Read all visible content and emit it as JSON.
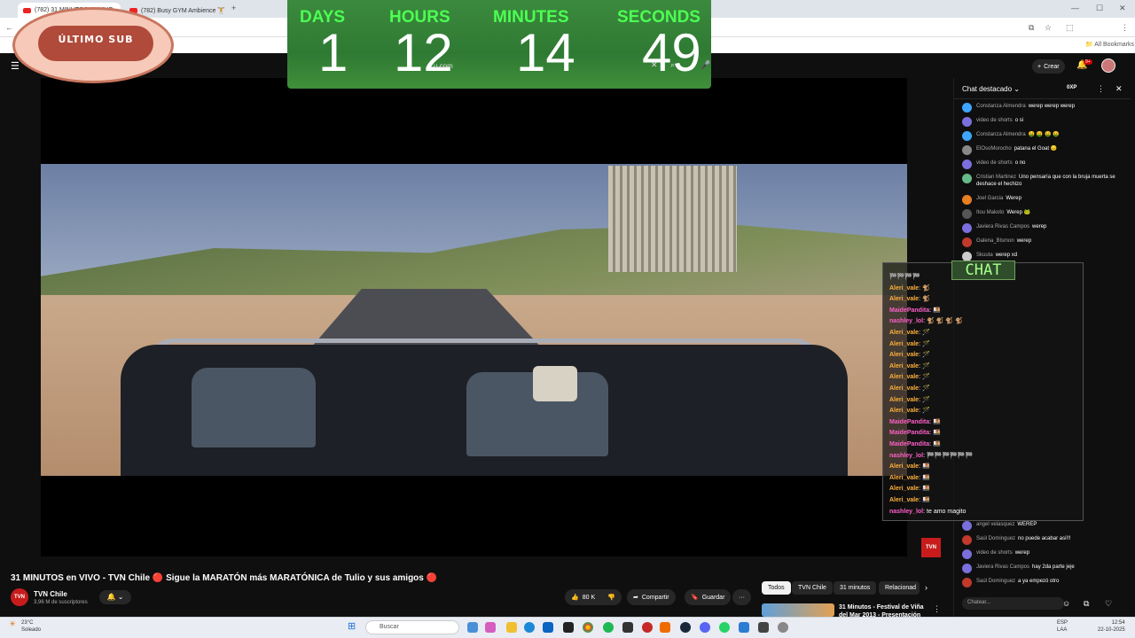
{
  "browser": {
    "tabs": [
      {
        "label": "(782) 31 MINUTOS en VIVO -",
        "active": true
      },
      {
        "label": "(782) Busy GYM Ambience 🏋",
        "active": false
      }
    ],
    "new_tab": "+",
    "bookmarks_label": "All Bookmarks",
    "notification_count": "9+"
  },
  "timer": {
    "labels": [
      "DAYS",
      "HOURS",
      "MINUTES",
      "SECONDS"
    ],
    "values": [
      "1",
      "12",
      "14",
      "49"
    ]
  },
  "overlay_badge": {
    "text": "ÚLTIMO SUB"
  },
  "youtube": {
    "create_label": "Crear",
    "search_hint": "u.com"
  },
  "video": {
    "title": "31 MINUTOS en VIVO - TVN Chile 🔴 Sigue la MARATÓN más MARATÓNICA de Tulio y sus amigos 🔴",
    "channel": "TVN Chile",
    "subscribers": "3,96 M de suscriptores",
    "channel_initials": "TVN",
    "likes": "80 K",
    "share": "Compartir",
    "save": "Guardar",
    "more": "···",
    "logo": "TVN"
  },
  "chips": [
    "Todos",
    "TVN Chile",
    "31 minutos",
    "Relacionad"
  ],
  "recommendation": {
    "title": "31 Minutos - Festival de Viña del Mar 2013 - Presentación"
  },
  "chat": {
    "title": "Chat destacado",
    "oxp": "0XP",
    "input_placeholder": "Chatear...",
    "messages": [
      {
        "author": "Constanza Almendra",
        "text": "werep werep werep",
        "color": "#3ea6ff"
      },
      {
        "author": "video de shorts",
        "text": "o si",
        "color": "#7a6fdc"
      },
      {
        "author": "Constanza Almendra",
        "text": "🤑 🤑 🤑 🤑",
        "color": "#3ea6ff"
      },
      {
        "author": "ElOsoMorocho",
        "text": "patana el Goat 😔",
        "color": "#888"
      },
      {
        "author": "video de shorts",
        "text": "o no",
        "color": "#7a6fdc"
      },
      {
        "author": "Cristian Martinez",
        "text": "Uno pensaría que con la bruja muerta se deshace el hechizo",
        "color": "#6b8"
      },
      {
        "author": "Joel Garcia",
        "text": "Werep",
        "color": "#e67e22"
      },
      {
        "author": "Itou Makoto",
        "text": "Werep 🐸",
        "color": "#555"
      },
      {
        "author": "Javiera Rivas Campos",
        "text": "werep",
        "color": "#7a6fdc"
      },
      {
        "author": "Galena_Blsmon",
        "text": "werep",
        "color": "#c0392b"
      },
      {
        "author": "Skuuta",
        "text": "werep xd",
        "color": "#ccc"
      },
      {
        "author": "",
        "text": "",
        "color": "#000"
      }
    ],
    "messages_bottom": [
      {
        "author": "angel velasquez",
        "text": "WEREP",
        "color": "#7a6fdc"
      },
      {
        "author": "Saúl Dominguez",
        "text": "no puede acabar asi!!!",
        "color": "#c0392b"
      },
      {
        "author": "video de shorts",
        "text": "werep",
        "color": "#7a6fdc"
      },
      {
        "author": "Javiera Rivas Campos",
        "text": "hay 2da parte jeje",
        "color": "#7a6fdc"
      },
      {
        "author": "Saúl Dominguez",
        "text": "a ya empezó otro",
        "color": "#c0392b"
      }
    ]
  },
  "overlay_chat": {
    "sign": "CHAT",
    "lines": [
      {
        "name": "",
        "text": "🏁🏁🏁🏁",
        "color": "#fff"
      },
      {
        "name": "Aleri_vale",
        "text": ": 🐒",
        "color": "#ffb03b"
      },
      {
        "name": "Aleri_vale",
        "text": ": 🐒",
        "color": "#ffb03b"
      },
      {
        "name": "MaidePandita",
        "text": ": 🍱",
        "color": "#ff5fc8"
      },
      {
        "name": "nashley_lol",
        "text": ": 🐒 🐒 🐒 🐒",
        "color": "#ff5fc8"
      },
      {
        "name": "Aleri_vale",
        "text": ": 🪄",
        "color": "#ffb03b"
      },
      {
        "name": "Aleri_vale",
        "text": ": 🪄",
        "color": "#ffb03b"
      },
      {
        "name": "Aleri_vale",
        "text": ": 🪄",
        "color": "#ffb03b"
      },
      {
        "name": "Aleri_vale",
        "text": ": 🪄",
        "color": "#ffb03b"
      },
      {
        "name": "Aleri_vale",
        "text": ": 🪄",
        "color": "#ffb03b"
      },
      {
        "name": "Aleri_vale",
        "text": ": 🪄",
        "color": "#ffb03b"
      },
      {
        "name": "Aleri_vale",
        "text": ": 🪄",
        "color": "#ffb03b"
      },
      {
        "name": "Aleri_vale",
        "text": ": 🪄",
        "color": "#ffb03b"
      },
      {
        "name": "MaidePandita",
        "text": ": 🍱",
        "color": "#ff5fc8"
      },
      {
        "name": "MaidePandita",
        "text": ": 🍱",
        "color": "#ff5fc8"
      },
      {
        "name": "MaidePandita",
        "text": ": 🍱",
        "color": "#ff5fc8"
      },
      {
        "name": "nashley_lol",
        "text": ": 🏁🏁🏁🏁🏁🏁",
        "color": "#ff5fc8"
      },
      {
        "name": "Aleri_vale",
        "text": ": 🍱",
        "color": "#ffb03b"
      },
      {
        "name": "Aleri_vale",
        "text": ": 🍱",
        "color": "#ffb03b"
      },
      {
        "name": "Aleri_vale",
        "text": ": 🍱",
        "color": "#ffb03b"
      },
      {
        "name": "Aleri_vale",
        "text": ": 🍱",
        "color": "#ffb03b"
      },
      {
        "name": "nashley_lol",
        "text": ": te amo magito",
        "color": "#ff5fc8"
      }
    ]
  },
  "taskbar": {
    "weather_temp": "23°C",
    "weather_desc": "Soleado",
    "search": "Buscar",
    "lang_1": "ESP",
    "lang_2": "LAA",
    "time": "12:54",
    "date": "22-10-2025"
  }
}
